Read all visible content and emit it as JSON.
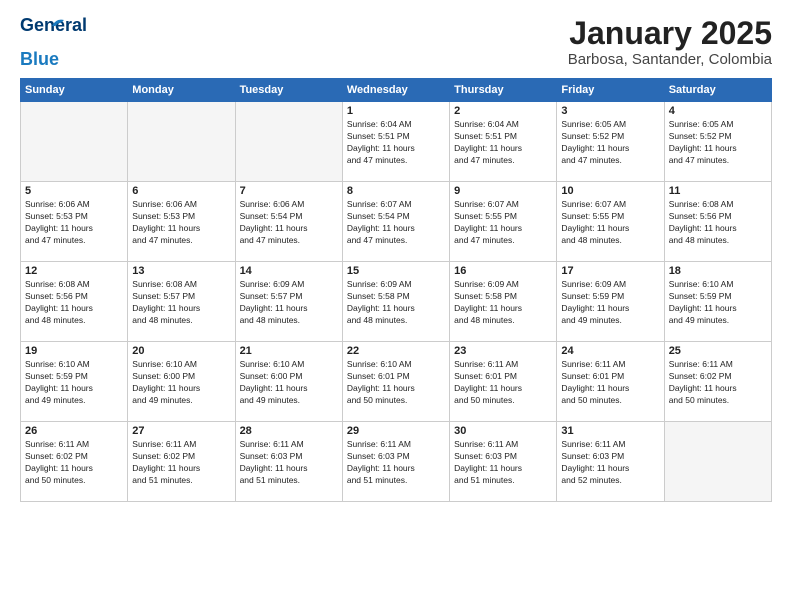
{
  "logo": {
    "line1": "General",
    "line2": "Blue"
  },
  "title": "January 2025",
  "subtitle": "Barbosa, Santander, Colombia",
  "days_of_week": [
    "Sunday",
    "Monday",
    "Tuesday",
    "Wednesday",
    "Thursday",
    "Friday",
    "Saturday"
  ],
  "weeks": [
    [
      {
        "day": "",
        "info": ""
      },
      {
        "day": "",
        "info": ""
      },
      {
        "day": "",
        "info": ""
      },
      {
        "day": "1",
        "info": "Sunrise: 6:04 AM\nSunset: 5:51 PM\nDaylight: 11 hours\nand 47 minutes."
      },
      {
        "day": "2",
        "info": "Sunrise: 6:04 AM\nSunset: 5:51 PM\nDaylight: 11 hours\nand 47 minutes."
      },
      {
        "day": "3",
        "info": "Sunrise: 6:05 AM\nSunset: 5:52 PM\nDaylight: 11 hours\nand 47 minutes."
      },
      {
        "day": "4",
        "info": "Sunrise: 6:05 AM\nSunset: 5:52 PM\nDaylight: 11 hours\nand 47 minutes."
      }
    ],
    [
      {
        "day": "5",
        "info": "Sunrise: 6:06 AM\nSunset: 5:53 PM\nDaylight: 11 hours\nand 47 minutes."
      },
      {
        "day": "6",
        "info": "Sunrise: 6:06 AM\nSunset: 5:53 PM\nDaylight: 11 hours\nand 47 minutes."
      },
      {
        "day": "7",
        "info": "Sunrise: 6:06 AM\nSunset: 5:54 PM\nDaylight: 11 hours\nand 47 minutes."
      },
      {
        "day": "8",
        "info": "Sunrise: 6:07 AM\nSunset: 5:54 PM\nDaylight: 11 hours\nand 47 minutes."
      },
      {
        "day": "9",
        "info": "Sunrise: 6:07 AM\nSunset: 5:55 PM\nDaylight: 11 hours\nand 47 minutes."
      },
      {
        "day": "10",
        "info": "Sunrise: 6:07 AM\nSunset: 5:55 PM\nDaylight: 11 hours\nand 48 minutes."
      },
      {
        "day": "11",
        "info": "Sunrise: 6:08 AM\nSunset: 5:56 PM\nDaylight: 11 hours\nand 48 minutes."
      }
    ],
    [
      {
        "day": "12",
        "info": "Sunrise: 6:08 AM\nSunset: 5:56 PM\nDaylight: 11 hours\nand 48 minutes."
      },
      {
        "day": "13",
        "info": "Sunrise: 6:08 AM\nSunset: 5:57 PM\nDaylight: 11 hours\nand 48 minutes."
      },
      {
        "day": "14",
        "info": "Sunrise: 6:09 AM\nSunset: 5:57 PM\nDaylight: 11 hours\nand 48 minutes."
      },
      {
        "day": "15",
        "info": "Sunrise: 6:09 AM\nSunset: 5:58 PM\nDaylight: 11 hours\nand 48 minutes."
      },
      {
        "day": "16",
        "info": "Sunrise: 6:09 AM\nSunset: 5:58 PM\nDaylight: 11 hours\nand 48 minutes."
      },
      {
        "day": "17",
        "info": "Sunrise: 6:09 AM\nSunset: 5:59 PM\nDaylight: 11 hours\nand 49 minutes."
      },
      {
        "day": "18",
        "info": "Sunrise: 6:10 AM\nSunset: 5:59 PM\nDaylight: 11 hours\nand 49 minutes."
      }
    ],
    [
      {
        "day": "19",
        "info": "Sunrise: 6:10 AM\nSunset: 5:59 PM\nDaylight: 11 hours\nand 49 minutes."
      },
      {
        "day": "20",
        "info": "Sunrise: 6:10 AM\nSunset: 6:00 PM\nDaylight: 11 hours\nand 49 minutes."
      },
      {
        "day": "21",
        "info": "Sunrise: 6:10 AM\nSunset: 6:00 PM\nDaylight: 11 hours\nand 49 minutes."
      },
      {
        "day": "22",
        "info": "Sunrise: 6:10 AM\nSunset: 6:01 PM\nDaylight: 11 hours\nand 50 minutes."
      },
      {
        "day": "23",
        "info": "Sunrise: 6:11 AM\nSunset: 6:01 PM\nDaylight: 11 hours\nand 50 minutes."
      },
      {
        "day": "24",
        "info": "Sunrise: 6:11 AM\nSunset: 6:01 PM\nDaylight: 11 hours\nand 50 minutes."
      },
      {
        "day": "25",
        "info": "Sunrise: 6:11 AM\nSunset: 6:02 PM\nDaylight: 11 hours\nand 50 minutes."
      }
    ],
    [
      {
        "day": "26",
        "info": "Sunrise: 6:11 AM\nSunset: 6:02 PM\nDaylight: 11 hours\nand 50 minutes."
      },
      {
        "day": "27",
        "info": "Sunrise: 6:11 AM\nSunset: 6:02 PM\nDaylight: 11 hours\nand 51 minutes."
      },
      {
        "day": "28",
        "info": "Sunrise: 6:11 AM\nSunset: 6:03 PM\nDaylight: 11 hours\nand 51 minutes."
      },
      {
        "day": "29",
        "info": "Sunrise: 6:11 AM\nSunset: 6:03 PM\nDaylight: 11 hours\nand 51 minutes."
      },
      {
        "day": "30",
        "info": "Sunrise: 6:11 AM\nSunset: 6:03 PM\nDaylight: 11 hours\nand 51 minutes."
      },
      {
        "day": "31",
        "info": "Sunrise: 6:11 AM\nSunset: 6:03 PM\nDaylight: 11 hours\nand 52 minutes."
      },
      {
        "day": "",
        "info": ""
      }
    ]
  ]
}
